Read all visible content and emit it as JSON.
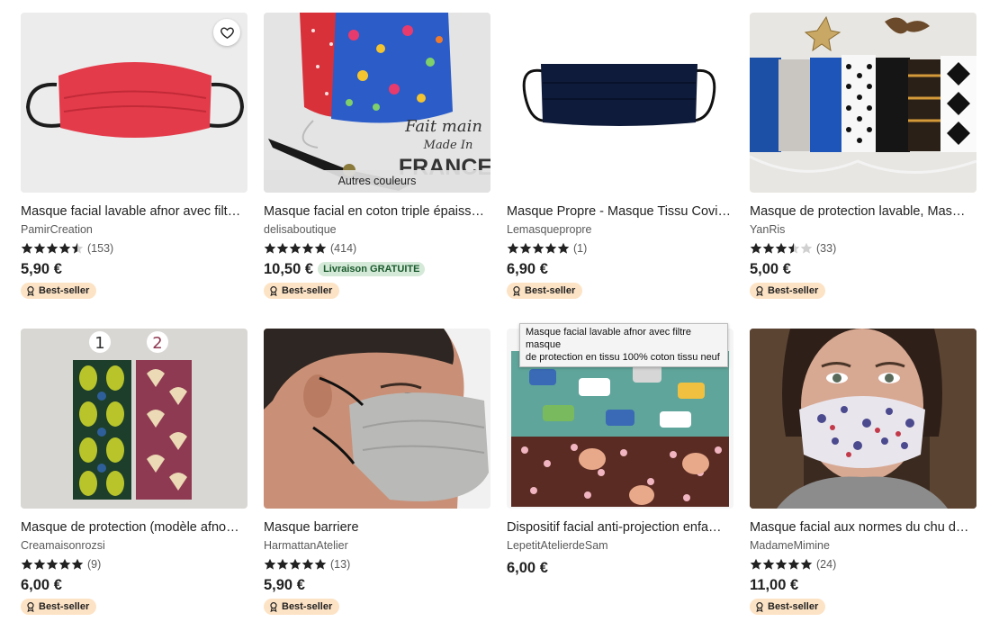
{
  "products": [
    {
      "title": "Masque facial lavable afnor avec filt…",
      "shop": "PamirCreation",
      "rating": 4.5,
      "reviews": "(153)",
      "price": "5,90 €",
      "badge": "Best-seller",
      "favorite_icon": "heart-icon"
    },
    {
      "title": "Masque facial en coton triple épaiss…",
      "shop": "delisaboutique",
      "rating": 5,
      "reviews": "(414)",
      "price": "10,50 €",
      "free_shipping": "Livraison GRATUITE",
      "badge": "Best-seller",
      "image_overlay": "Autres couleurs",
      "image_text": {
        "line1": "Fait main",
        "line2": "Made In",
        "line3": "FRANCE"
      }
    },
    {
      "title": "Masque Propre - Masque Tissu Covi…",
      "shop": "Lemasquepropre",
      "rating": 5,
      "reviews": "(1)",
      "price": "6,90 €",
      "badge": "Best-seller"
    },
    {
      "title": "Masque de protection lavable, Mas…",
      "shop": "YanRis",
      "rating": 3.5,
      "reviews": "(33)",
      "price": "5,00 €",
      "badge": "Best-seller"
    },
    {
      "title": "Masque de protection (modèle afno…",
      "shop": "Creamaisonrozsi",
      "rating": 5,
      "reviews": "(9)",
      "price": "6,00 €",
      "badge": "Best-seller",
      "image_text": {
        "num1": "1",
        "num2": "2"
      }
    },
    {
      "title": "Masque barriere",
      "shop": "HarmattanAtelier",
      "rating": 5,
      "reviews": "(13)",
      "price": "5,90 €",
      "badge": "Best-seller"
    },
    {
      "title": "Dispositif facial anti-projection enfa…",
      "shop": "LepetitAtelierdeSam",
      "price": "6,00 €"
    },
    {
      "title": "Masque facial aux normes du chu d…",
      "shop": "MadameMimine",
      "rating": 5,
      "reviews": "(24)",
      "price": "11,00 €",
      "badge": "Best-seller"
    }
  ],
  "tooltip": {
    "line1": "Masque facial lavable afnor avec filtre masque",
    "line2": "de protection en tissu 100% coton tissu neuf"
  },
  "colors": {
    "star": "#222222",
    "star_empty": "#d0d0d0",
    "badge_bg": "#fde3c5",
    "free_shipping_bg": "#d4e9d7"
  }
}
